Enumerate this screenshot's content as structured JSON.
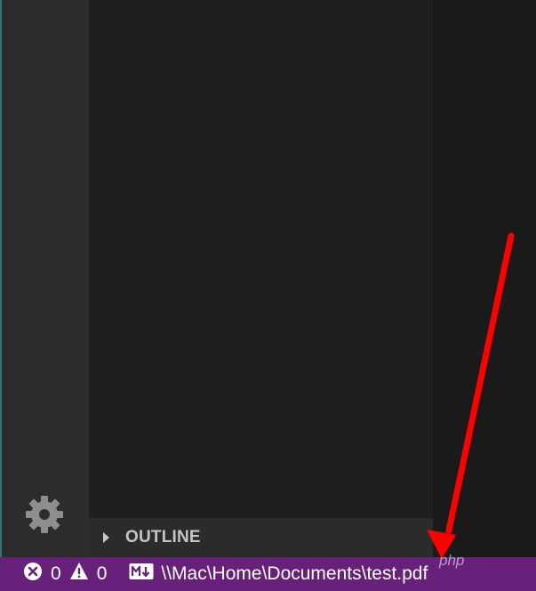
{
  "sidebar": {
    "outline_title": "OUTLINE"
  },
  "status_bar": {
    "errors_count": "0",
    "warnings_count": "0",
    "file_path": "\\\\Mac\\Home\\Documents\\test.pdf"
  },
  "watermark": {
    "text": "php"
  },
  "colors": {
    "status_bar_bg": "#68217a",
    "activity_bar_bg": "#2c2c2c",
    "sidebar_bg": "#1f1f1f",
    "outline_header_bg": "#2b2b2b",
    "annotation_arrow": "#ff0000"
  },
  "icons": {
    "settings": "gear-icon",
    "outline_toggle": "chevron-right-icon",
    "errors": "error-circle-icon",
    "warnings": "warning-triangle-icon",
    "language": "markdown-icon"
  }
}
